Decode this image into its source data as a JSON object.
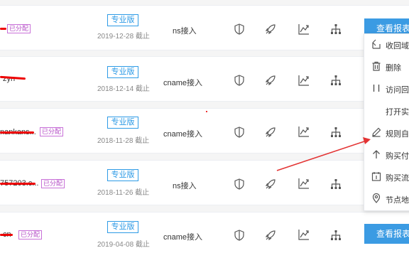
{
  "rows": [
    {
      "domain": "",
      "assigned_tag": "已分配",
      "edition": "专业版",
      "expiry_date": "2019-12-28",
      "expiry_suffix": "截止",
      "access_type": "ns接入",
      "report_button": "查看报表"
    },
    {
      "domain": "zyn",
      "assigned_tag": "",
      "edition": "专业版",
      "expiry_date": "2018-12-14",
      "expiry_suffix": "截止",
      "access_type": "cname接入",
      "report_button": ""
    },
    {
      "domain": "nankans...",
      "assigned_tag": "已分配",
      "edition": "专业版",
      "expiry_date": "2018-11-28",
      "expiry_suffix": "截止",
      "access_type": "cname接入",
      "report_button": ""
    },
    {
      "domain": "757203.c...",
      "assigned_tag": "已分配",
      "edition": "专业版",
      "expiry_date": "2018-11-26",
      "expiry_suffix": "截止",
      "access_type": "ns接入",
      "report_button": ""
    },
    {
      "domain": "cn",
      "assigned_tag": "已分配",
      "edition": "专业版",
      "expiry_date": "2019-04-08",
      "expiry_suffix": "截止",
      "access_type": "cname接入",
      "report_button": "查看报表"
    }
  ],
  "action_icons": [
    "shield-icon",
    "rocket-icon",
    "line-chart-icon",
    "sitemap-icon"
  ],
  "dropdown_menu": [
    {
      "label": "收回域名",
      "icon": "reclaim-icon"
    },
    {
      "label": "删除",
      "icon": "trash-icon"
    },
    {
      "label": "访问回源",
      "icon": "origin-icon"
    },
    {
      "label": "打开实时",
      "icon": ""
    },
    {
      "label": "规则自定",
      "icon": "pencil-icon"
    },
    {
      "label": "购买付费",
      "icon": "upload-icon"
    },
    {
      "label": "购买流量",
      "icon": "calendar-icon"
    },
    {
      "label": "节点地图",
      "icon": "map-pin-icon"
    }
  ],
  "colors": {
    "accent": "#3b9be3",
    "tag": "#b44cc6",
    "annotation": "#e33333"
  }
}
